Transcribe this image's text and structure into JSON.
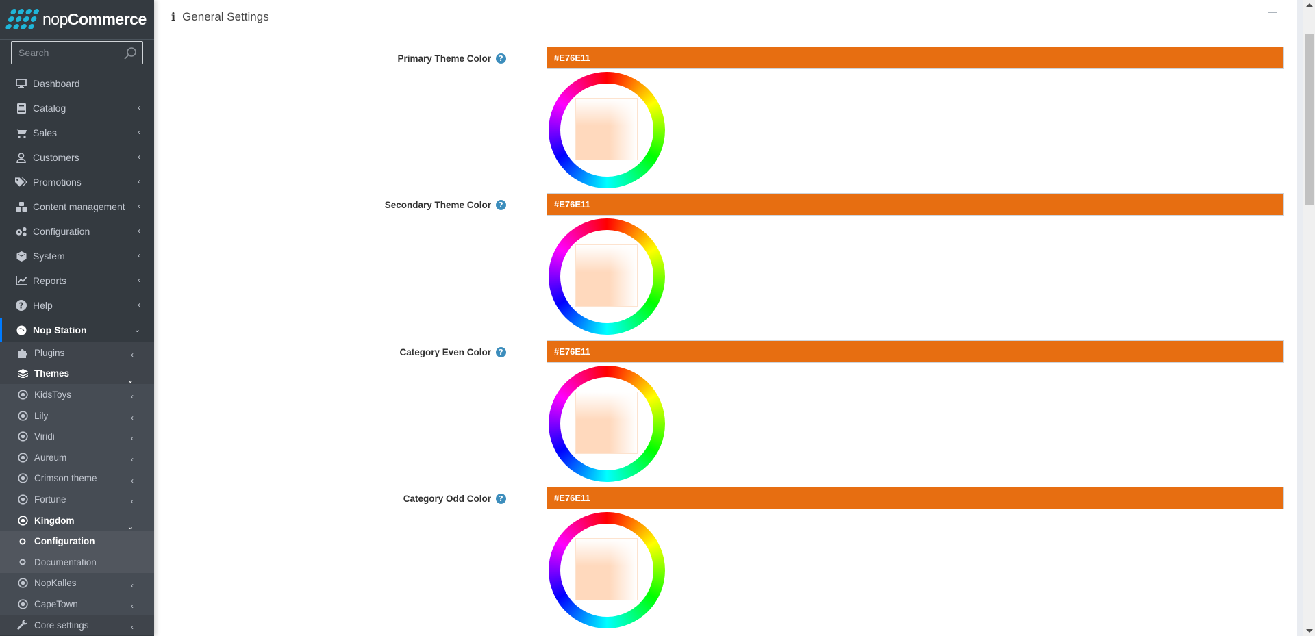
{
  "brand": {
    "name_light": "nop",
    "name_bold": "Commerce"
  },
  "search": {
    "placeholder": "Search"
  },
  "sidebar": {
    "items": [
      {
        "label": "Dashboard",
        "icon": "desktop-icon",
        "has_children": false
      },
      {
        "label": "Catalog",
        "icon": "book-icon",
        "has_children": true
      },
      {
        "label": "Sales",
        "icon": "cart-icon",
        "has_children": true
      },
      {
        "label": "Customers",
        "icon": "user-icon",
        "has_children": true
      },
      {
        "label": "Promotions",
        "icon": "tags-icon",
        "has_children": true
      },
      {
        "label": "Content management",
        "icon": "cubes-icon",
        "has_children": true
      },
      {
        "label": "Configuration",
        "icon": "gears-icon",
        "has_children": true
      },
      {
        "label": "System",
        "icon": "cube-icon",
        "has_children": true
      },
      {
        "label": "Reports",
        "icon": "chart-line-icon",
        "has_children": true
      },
      {
        "label": "Help",
        "icon": "question-circle-icon",
        "has_children": true
      },
      {
        "label": "Nop Station",
        "icon": "nopstation-icon",
        "has_children": true,
        "expanded": true,
        "active": true
      }
    ],
    "nop_station": {
      "plugins": "Plugins",
      "themes": "Themes",
      "theme_items": [
        "KidsToys",
        "Lily",
        "Viridi",
        "Aureum",
        "Crimson theme",
        "Fortune"
      ],
      "kingdom": {
        "label": "Kingdom",
        "children": [
          {
            "label": "Configuration",
            "current": true
          },
          {
            "label": "Documentation",
            "current": false
          }
        ]
      },
      "theme_items_after": [
        "NopKalles",
        "CapeTown"
      ],
      "core_settings": "Core settings"
    }
  },
  "card": {
    "title": "General Settings",
    "icon": "info-icon",
    "collapse_icon": "minus-icon"
  },
  "settings": [
    {
      "label": "Primary Theme Color",
      "value": "#E76E11"
    },
    {
      "label": "Secondary Theme Color",
      "value": "#E76E11"
    },
    {
      "label": "Category Even Color",
      "value": "#E76E11"
    },
    {
      "label": "Category Odd Color",
      "value": "#E76E11"
    }
  ],
  "colors": {
    "sidebar_bg": "#343a40",
    "accent_blue": "#007bff",
    "brand_cyan": "#1fb6d9",
    "picked_color": "#E76E11",
    "help_icon": "#3c8dbc"
  }
}
